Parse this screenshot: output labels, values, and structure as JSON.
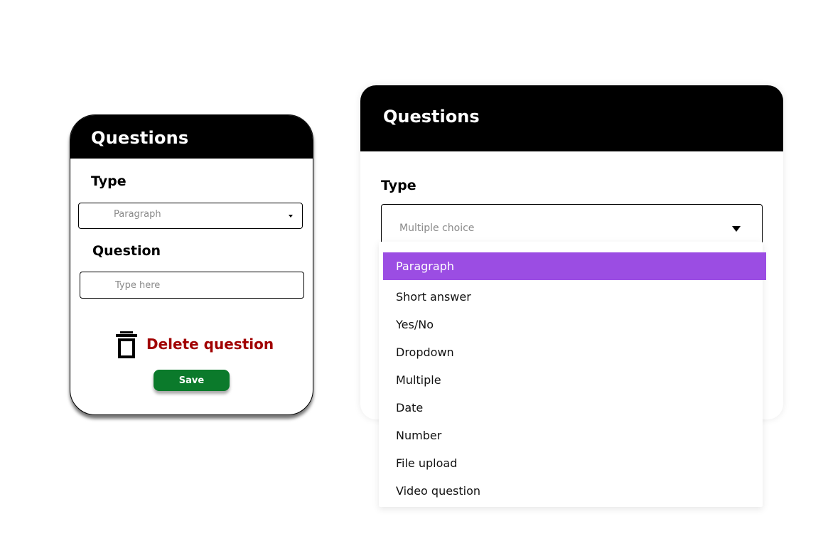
{
  "small_card": {
    "title": "Questions",
    "type_label": "Type",
    "type_value": "Paragraph",
    "question_label": "Question",
    "question_placeholder": "Type here",
    "delete_label": "Delete question",
    "save_label": "Save"
  },
  "large_card": {
    "title": "Questions",
    "type_label": "Type",
    "type_value": "Multiple choice"
  },
  "dropdown": {
    "selected_index": 0,
    "options": [
      "Paragraph",
      "Short answer",
      "Yes/No",
      "Dropdown",
      "Multiple",
      "Date",
      "Number",
      "File upload",
      "Video question"
    ]
  },
  "colors": {
    "header_bg": "#000000",
    "delete_red": "#a10000",
    "save_green": "#0b7a2b",
    "highlight_purple": "#9b4de3"
  },
  "icons": {
    "delete": "trash-icon",
    "small_select_caret": "caret-down-icon",
    "large_select_caret": "triangle-down-icon"
  }
}
